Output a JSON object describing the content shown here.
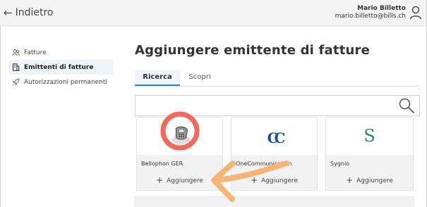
{
  "header": {
    "back_label": "Indietro",
    "user_name": "Mario Billetto",
    "user_email": "mario.billetto@bills.ch",
    "user_icon": "user-icon"
  },
  "sidebar": {
    "items": [
      {
        "label": "Fatture",
        "icon": "people-icon",
        "active": false
      },
      {
        "label": "Emittenti di fatture",
        "icon": "building-icon",
        "active": true
      },
      {
        "label": "Autorizzazioni permanenti",
        "icon": "rocket-icon",
        "active": false
      }
    ]
  },
  "main": {
    "title": "Aggiungere emittente di fatture",
    "tabs": [
      {
        "label": "Ricerca",
        "active": true
      },
      {
        "label": "Scopri",
        "active": false
      }
    ],
    "search": {
      "placeholder": "",
      "value": "",
      "icon": "search-icon"
    },
    "cards": [
      {
        "name": "Bellophon GER",
        "add_label": "Aggiungere",
        "logo": "phone-logo"
      },
      {
        "name": "OneCommunication",
        "add_label": "Aggiungere",
        "logo": "oc-logo"
      },
      {
        "name": "Sygnio",
        "add_label": "Aggiungere",
        "logo": "s-logo"
      }
    ]
  },
  "annotations": {
    "circle_color": "#ef6a5a",
    "arrow_color": "#f3b676"
  },
  "colors": {
    "accent": "#2e86c1",
    "active_bg": "#eef5fb"
  }
}
